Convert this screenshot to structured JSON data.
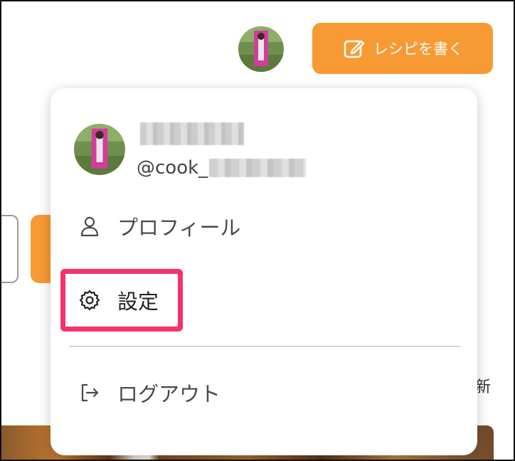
{
  "header": {
    "write_recipe_label": "レシピを書く",
    "pen_icon": "pen-square-icon",
    "avatar": "user-avatar"
  },
  "background": {
    "new_label": "新"
  },
  "user_menu": {
    "handle_prefix": "@cook_",
    "items": [
      {
        "label": "プロフィール",
        "icon": "person-icon"
      },
      {
        "label": "設定",
        "icon": "gear-icon"
      },
      {
        "label": "ログアウト",
        "icon": "logout-icon"
      }
    ]
  },
  "colors": {
    "accent": "#f79a33",
    "highlight": "#f5336b"
  }
}
